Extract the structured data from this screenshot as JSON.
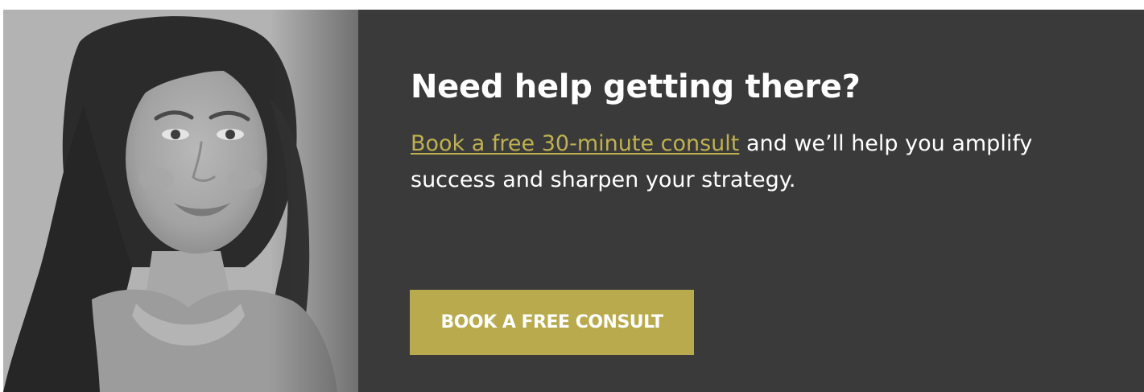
{
  "banner": {
    "headline": "Need help getting there?",
    "link_text": "Book a free 30-minute consult",
    "body_rest": " and we’ll help you amplify success and sharpen your strategy.",
    "cta_label": "BOOK A FREE CONSULT"
  },
  "colors": {
    "panel_background": "#3a3a3a",
    "link_accent": "#bfb050",
    "button_background": "#b9aa4d",
    "text": "#ffffff"
  },
  "image": {
    "semantic": "grayscale-portrait-woman-photo"
  }
}
